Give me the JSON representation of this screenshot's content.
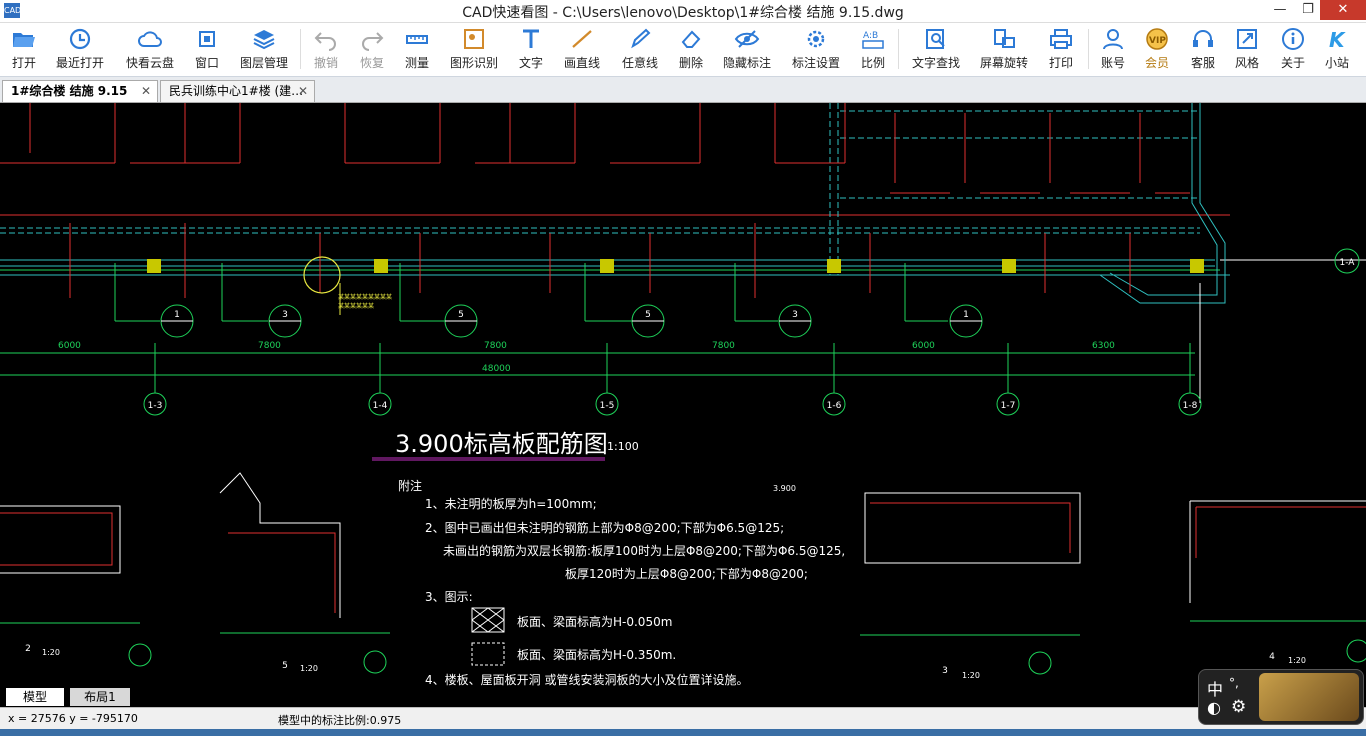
{
  "window": {
    "title": "CAD快速看图 - C:\\Users\\lenovo\\Desktop\\1#综合楼 结施 9.15.dwg",
    "logo": "CAD"
  },
  "toolbar": {
    "items": [
      {
        "label": "打开",
        "icon": "folder-open-icon"
      },
      {
        "label": "最近打开",
        "icon": "recent-icon"
      },
      {
        "label": "快看云盘",
        "icon": "cloud-icon"
      },
      {
        "label": "窗口",
        "icon": "window-icon"
      },
      {
        "label": "图层管理",
        "icon": "layers-icon"
      },
      {
        "label": "撤销",
        "icon": "undo-icon"
      },
      {
        "label": "恢复",
        "icon": "redo-icon"
      },
      {
        "label": "测量",
        "icon": "measure-icon"
      },
      {
        "label": "图形识别",
        "icon": "shape-recognize-icon"
      },
      {
        "label": "文字",
        "icon": "text-icon"
      },
      {
        "label": "画直线",
        "icon": "line-icon"
      },
      {
        "label": "任意线",
        "icon": "pen-icon"
      },
      {
        "label": "删除",
        "icon": "eraser-icon"
      },
      {
        "label": "隐藏标注",
        "icon": "eye-hide-icon"
      },
      {
        "label": "标注设置",
        "icon": "annotation-settings-icon"
      },
      {
        "label": "比例",
        "icon": "scale-icon"
      },
      {
        "label": "文字查找",
        "icon": "text-search-icon"
      },
      {
        "label": "屏幕旋转",
        "icon": "rotate-icon"
      },
      {
        "label": "打印",
        "icon": "print-icon"
      },
      {
        "label": "账号",
        "icon": "user-icon"
      },
      {
        "label": "会员",
        "icon": "vip-icon"
      },
      {
        "label": "客服",
        "icon": "headset-icon"
      },
      {
        "label": "风格",
        "icon": "style-icon"
      },
      {
        "label": "关于",
        "icon": "info-icon"
      },
      {
        "label": "小站",
        "icon": "k-logo-icon"
      }
    ]
  },
  "tabs": [
    {
      "label": "1#综合楼  结施  9.15",
      "close": "✕"
    },
    {
      "label": "民兵训练中心1#楼 (建…",
      "close": "✕"
    }
  ],
  "drawing": {
    "title": "3.900标高板配筋图",
    "scale": "1:100",
    "notes_heading": "附注",
    "notes": [
      "1、未注明的板厚为h=100mm;",
      "2、图中已画出但未注明的钢筋上部为Φ8@200;下部为Φ6.5@125;",
      "未画出的钢筋为双层长钢筋:板厚100时为上层Φ8@200;下部为Φ6.5@125,",
      "板厚120时为上层Φ8@200;下部为Φ8@200;",
      "3、图示:",
      "板面、梁面标高为H-0.050m",
      "板面、梁面标高为H-0.350m.",
      "4、楼板、屋面板开洞 或管线安装洞板的大小及位置详设施。"
    ],
    "axis_labels": [
      "1-3",
      "1-4",
      "1-5",
      "1-6",
      "1-7",
      "1-8",
      "1-A"
    ],
    "spans": [
      "6000",
      "7800",
      "7800",
      "7800",
      "6000",
      "6300"
    ],
    "total": "48000",
    "section_marks": [
      "1",
      "3",
      "5",
      "5",
      "3",
      "1"
    ],
    "detail_marks": [
      "2",
      "5",
      "3",
      "4"
    ],
    "detail_scale": "1:20",
    "elevation": "3.900",
    "annotation_yellow": [
      "某某某某某某某某某",
      "某某某某某某"
    ]
  },
  "layout_tabs": [
    "模型",
    "布局1"
  ],
  "status": {
    "coords": "x = 27576 y = -795170",
    "scale_text": "模型中的标注比例:0.975"
  },
  "widget": {
    "zh": "中",
    "dots": "°,",
    "moon": "◐",
    "gear": "⚙"
  }
}
